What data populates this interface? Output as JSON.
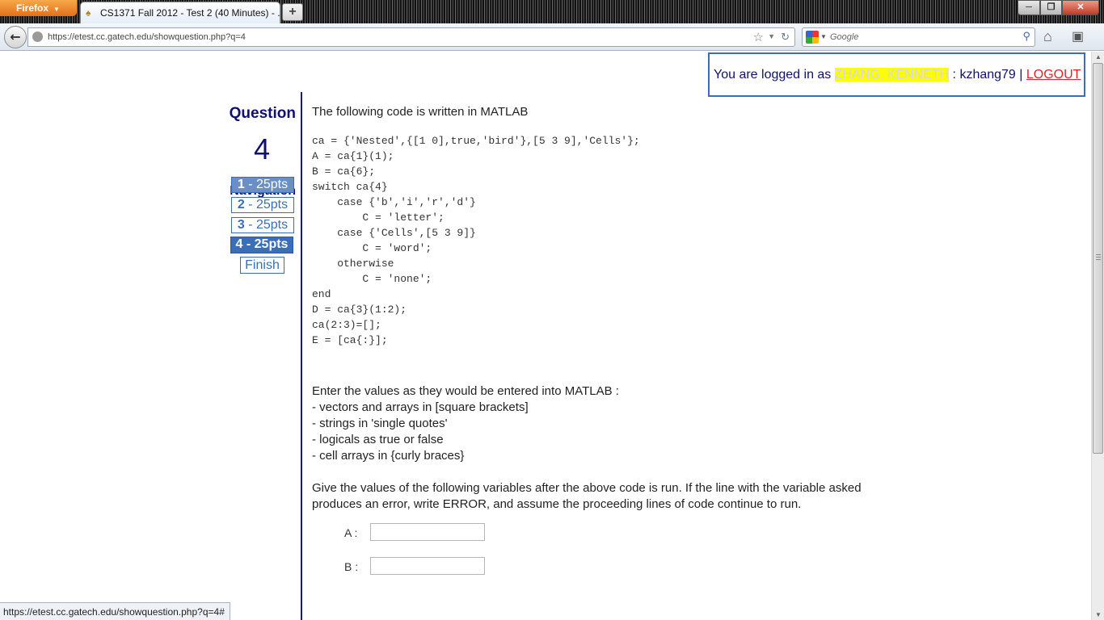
{
  "browser": {
    "app_button": "Firefox",
    "tab_title": "CS1371 Fall 2012 - Test 2 (40 Minutes) - ...",
    "url": "https://etest.cc.gatech.edu/showquestion.php?q=4",
    "search_placeholder": "Google",
    "status_url": "https://etest.cc.gatech.edu/showquestion.php?q=4#"
  },
  "login": {
    "prefix": "You are logged in as ",
    "name": "ZHANG, KENNETH",
    "separator": " : ",
    "username": "kzhang79",
    "divider": " | ",
    "logout": "LOGOUT"
  },
  "sidebar": {
    "question_heading": "Question",
    "question_number": "4",
    "navigation_heading": "Navigation",
    "questions": [
      {
        "num": "1",
        "label": " - 25pts"
      },
      {
        "num": "2",
        "label": " - 25pts"
      },
      {
        "num": "3",
        "label": " - 25pts"
      },
      {
        "num": "4",
        "label": " - 25pts"
      }
    ],
    "finish": "Finish"
  },
  "content": {
    "intro": "The following code is written in MATLAB",
    "code": "ca = {'Nested',{[1 0],true,'bird'},[5 3 9],'Cells'};\nA = ca{1}(1);\nB = ca{6};\nswitch ca{4}\n    case {'b','i','r','d'}\n        C = 'letter';\n    case {'Cells',[5 3 9]}\n        C = 'word';\n    otherwise\n        C = 'none';\nend\nD = ca{3}(1:2);\nca(2:3)=[];\nE = [ca{:}];",
    "instructions": [
      "Enter the values as they would be entered into MATLAB :",
      "- vectors and arrays in [square brackets]",
      "- strings in 'single quotes'",
      "- logicals as true or false",
      "- cell arrays in {curly braces}"
    ],
    "prompt": "Give the values of the following variables after the above code is run. If the line with the variable asked produces an error, write ERROR, and assume the proceeding lines of code continue to run.",
    "answers": [
      {
        "label": "A :",
        "value": ""
      },
      {
        "label": "B :",
        "value": ""
      }
    ]
  }
}
